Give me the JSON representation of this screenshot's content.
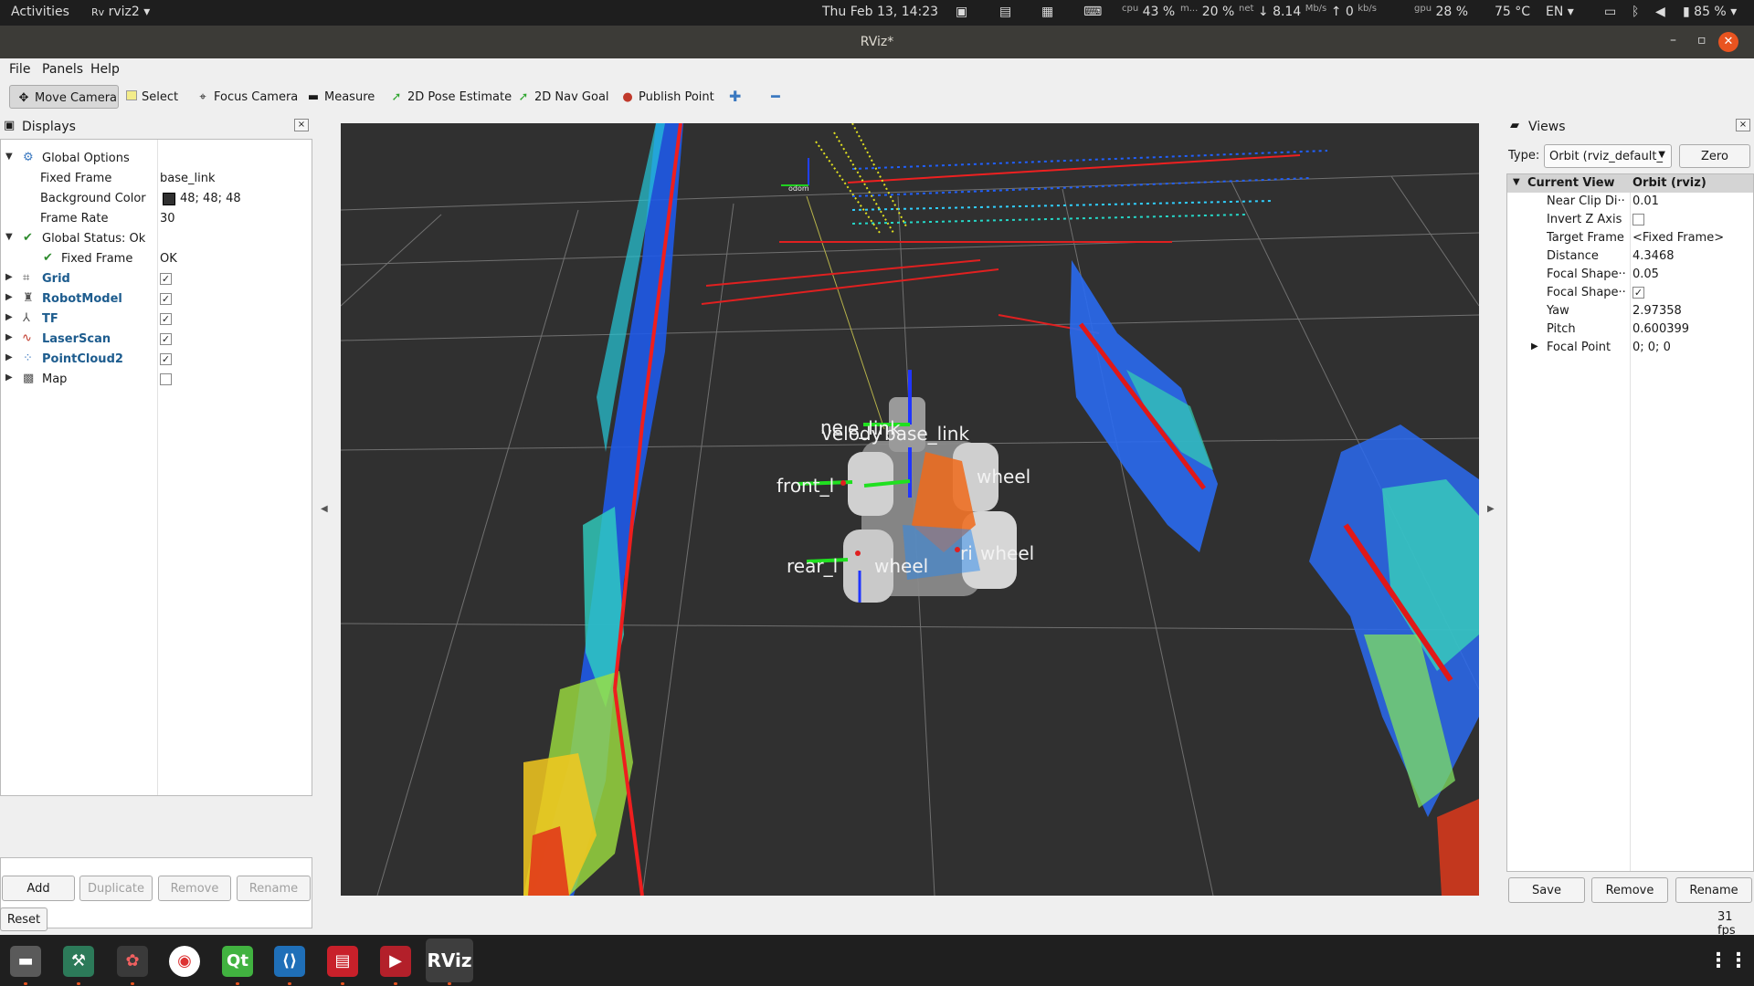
{
  "topbar": {
    "activities": "Activities",
    "app_menu": "rviz2",
    "clock": "Thu Feb 13, 14:23",
    "cpu_label": "cpu",
    "cpu_value": "43 %",
    "mem_label": "m...",
    "mem_value": "20 %",
    "net_label": "net",
    "net_down": "8.14",
    "net_down_unit": "Mb/s",
    "net_up": "0",
    "net_up_unit": "kb/s",
    "gpu_label": "gpu",
    "gpu_value": "28 %",
    "temp": "75 °C",
    "lang": "EN",
    "battery": "85 %"
  },
  "window": {
    "title": "RViz*"
  },
  "menu": {
    "file": "File",
    "panels": "Panels",
    "help": "Help"
  },
  "toolbar": {
    "move_camera": "Move Camera",
    "select": "Select",
    "focus_camera": "Focus Camera",
    "measure": "Measure",
    "pose_estimate": "2D Pose Estimate",
    "nav_goal": "2D Nav Goal",
    "publish_point": "Publish Point"
  },
  "displays": {
    "title": "Displays",
    "global_options": "Global Options",
    "fixed_frame_label": "Fixed Frame",
    "fixed_frame_value": "base_link",
    "bg_color_label": "Background Color",
    "bg_color_value": "48; 48; 48",
    "frame_rate_label": "Frame Rate",
    "frame_rate_value": "30",
    "global_status": "Global Status: Ok",
    "status_fixed_frame_label": "Fixed Frame",
    "status_fixed_frame_value": "OK",
    "items": [
      {
        "label": "Grid",
        "checked": true
      },
      {
        "label": "RobotModel",
        "checked": true
      },
      {
        "label": "TF",
        "checked": true
      },
      {
        "label": "LaserScan",
        "checked": true
      },
      {
        "label": "PointCloud2",
        "checked": true
      },
      {
        "label": "Map",
        "checked": false
      }
    ],
    "add": "Add",
    "duplicate": "Duplicate",
    "remove": "Remove",
    "rename": "Rename"
  },
  "viewport": {
    "frame_labels": {
      "velodyne": "velody",
      "velodyne_overlap": "ne",
      "base_link": "base_link",
      "front_left": "front_l",
      "front_right": "wheel",
      "rear_left": "rear_l",
      "rear_left_tail": "wheel",
      "rear_right": "ri",
      "rear_right_tail": "wheel",
      "top_label": "e_link",
      "odom": "odom"
    },
    "colors": {
      "background": "#303030",
      "grid": "#a0a0a0"
    }
  },
  "views": {
    "title": "Views",
    "type_label": "Type:",
    "type_value": "Orbit (rviz_default_",
    "zero": "Zero",
    "current_view": "Current View",
    "current_view_value": "Orbit (rviz)",
    "props": [
      {
        "label": "Near Clip Di···",
        "value": "0.01"
      },
      {
        "label": "Invert Z Axis",
        "value": ""
      },
      {
        "label": "Target Frame",
        "value": "<Fixed Frame>"
      },
      {
        "label": "Distance",
        "value": "4.3468"
      },
      {
        "label": "Focal Shape···",
        "value": "0.05"
      },
      {
        "label": "Focal Shape···",
        "value": ""
      },
      {
        "label": "Yaw",
        "value": "2.97358"
      },
      {
        "label": "Pitch",
        "value": "0.600399"
      },
      {
        "label": "Focal Point",
        "value": "0; 0; 0"
      }
    ],
    "save": "Save",
    "remove": "Remove",
    "rename": "Rename"
  },
  "statusbar": {
    "reset": "Reset",
    "fps": "31 fps"
  },
  "taskbar": {
    "rviz_label": "RViz"
  },
  "brand": {
    "accent": "#e95420",
    "link_blue": "#1d5c8e"
  }
}
